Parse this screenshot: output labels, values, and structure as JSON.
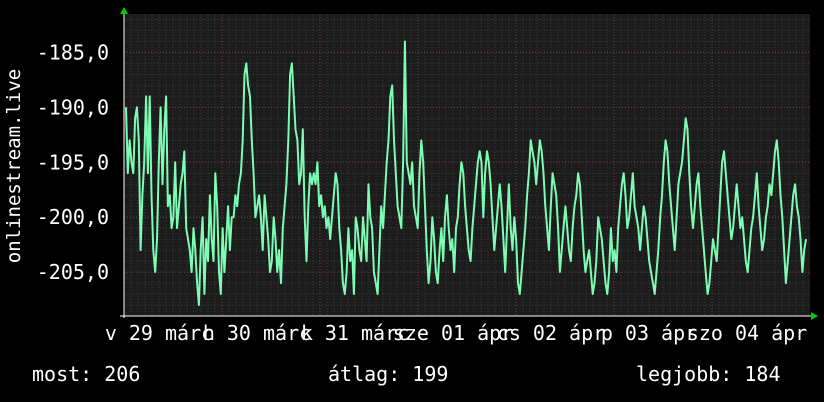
{
  "chart_data": {
    "type": "line",
    "ylabel": "onlinestream.live",
    "ylim": [
      -209,
      -181.5
    ],
    "yticks": [
      {
        "value": -185,
        "label": "-185,0"
      },
      {
        "value": -190,
        "label": "-190,0"
      },
      {
        "value": -195,
        "label": "-195,0"
      },
      {
        "value": -200,
        "label": "-200,0"
      },
      {
        "value": -205,
        "label": "-205,0"
      }
    ],
    "xticks": [
      "v 29 márc",
      "h 30 márc",
      "k 31 márc",
      "sze 01 ápr",
      "cs 02 ápr",
      "p 03 ápr",
      "szo 04 ápr"
    ],
    "grid": true,
    "colors": {
      "line": "#7dfcb4",
      "background": "#000000",
      "plot": "#1c1c1c",
      "grid": "#3a3a3a",
      "grid_minor_x": "#7a3a44",
      "axis": "#ffffff",
      "arrow": "#00cc00"
    },
    "series": [
      {
        "values": [
          -190,
          -196,
          -193,
          -195,
          -196,
          -191,
          -190,
          -193,
          -203,
          -198,
          -195,
          -189,
          -196,
          -189,
          -198,
          -203,
          -205,
          -202,
          -195,
          -190,
          -197,
          -192,
          -189,
          -199,
          -198,
          -201,
          -200,
          -195,
          -201,
          -199,
          -197,
          -196,
          -194,
          -201,
          -202,
          -203,
          -205,
          -201,
          -203,
          -206,
          -208,
          -203,
          -200,
          -207,
          -202,
          -204,
          -198,
          -202,
          -204,
          -196,
          -199,
          -205,
          -207,
          -201,
          -205,
          -202,
          -199,
          -203,
          -200,
          -200,
          -198,
          -199,
          -197,
          -196,
          -193,
          -187,
          -186,
          -188,
          -189,
          -193,
          -196,
          -200,
          -199,
          -198,
          -200,
          -203,
          -198,
          -200,
          -202,
          -205,
          -204,
          -200,
          -202,
          -205,
          -203,
          -206,
          -201,
          -199,
          -197,
          -193,
          -187,
          -186,
          -189,
          -192,
          -193,
          -197,
          -196,
          -192,
          -200,
          -204,
          -199,
          -196,
          -197,
          -196,
          -197,
          -195,
          -199,
          -198,
          -200,
          -199,
          -201,
          -200,
          -202,
          -200,
          -198,
          -196,
          -197,
          -201,
          -203,
          -206,
          -207,
          -205,
          -201,
          -204,
          -203,
          -207,
          -200,
          -201,
          -203,
          -204,
          -200,
          -202,
          -204,
          -197,
          -200,
          -201,
          -205,
          -206,
          -207,
          -203,
          -199,
          -201,
          -198,
          -195,
          -193,
          -189,
          -188,
          -193,
          -196,
          -199,
          -200,
          -201,
          -195,
          -184,
          -195,
          -196,
          -197,
          -195,
          -199,
          -200,
          -201,
          -196,
          -193,
          -195,
          -199,
          -203,
          -206,
          -204,
          -200,
          -202,
          -205,
          -206,
          -203,
          -201,
          -204,
          -200,
          -198,
          -201,
          -203,
          -202,
          -205,
          -201,
          -200,
          -197,
          -195,
          -196,
          -199,
          -201,
          -203,
          -204,
          -201,
          -199,
          -197,
          -195,
          -194,
          -195,
          -200,
          -196,
          -194,
          -195,
          -197,
          -200,
          -203,
          -201,
          -199,
          -197,
          -199,
          -202,
          -205,
          -201,
          -197,
          -201,
          -203,
          -200,
          -202,
          -206,
          -207,
          -205,
          -203,
          -201,
          -198,
          -196,
          -193,
          -194,
          -195,
          -197,
          -195,
          -193,
          -194,
          -196,
          -199,
          -201,
          -203,
          -199,
          -196,
          -197,
          -198,
          -201,
          -205,
          -203,
          -201,
          -199,
          -201,
          -203,
          -204,
          -201,
          -199,
          -198,
          -196,
          -197,
          -200,
          -203,
          -205,
          -204,
          -203,
          -205,
          -207,
          -206,
          -204,
          -200,
          -201,
          -202,
          -204,
          -206,
          -207,
          -205,
          -201,
          -204,
          -203,
          -205,
          -201,
          -199,
          -197,
          -196,
          -198,
          -201,
          -200,
          -198,
          -196,
          -199,
          -200,
          -201,
          -203,
          -201,
          -199,
          -200,
          -202,
          -204,
          -205,
          -206,
          -207,
          -205,
          -203,
          -200,
          -198,
          -195,
          -193,
          -194,
          -197,
          -199,
          -201,
          -203,
          -200,
          -197,
          -196,
          -195,
          -193,
          -191,
          -192,
          -196,
          -199,
          -201,
          -199,
          -197,
          -196,
          -199,
          -201,
          -203,
          -205,
          -207,
          -206,
          -204,
          -202,
          -203,
          -204,
          -201,
          -198,
          -195,
          -194,
          -196,
          -198,
          -200,
          -202,
          -201,
          -199,
          -197,
          -199,
          -201,
          -200,
          -202,
          -204,
          -205,
          -203,
          -201,
          -200,
          -198,
          -196,
          -199,
          -201,
          -203,
          -202,
          -200,
          -199,
          -197,
          -198,
          -196,
          -194,
          -193,
          -195,
          -198,
          -200,
          -203,
          -206,
          -204,
          -202,
          -200,
          -198,
          -197,
          -199,
          -200,
          -202,
          -205,
          -203,
          -202
        ]
      }
    ]
  },
  "stats": {
    "current": "most: 206",
    "average": "átlag: 199",
    "best": "legjobb: 184"
  }
}
